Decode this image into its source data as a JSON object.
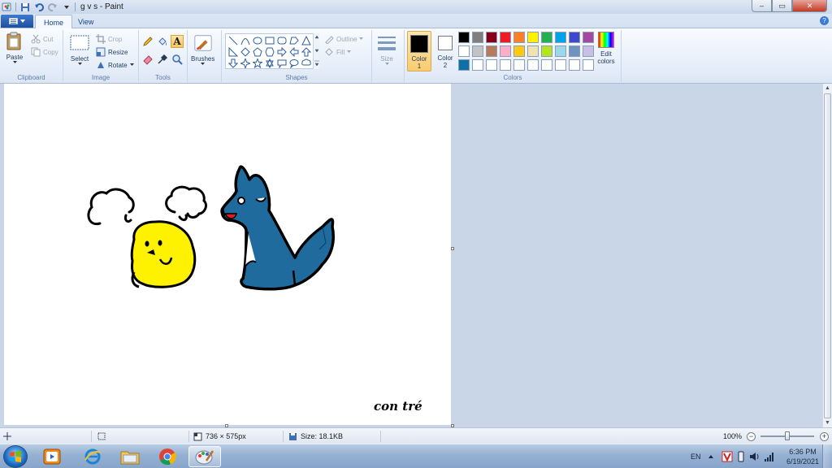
{
  "window": {
    "title": "g v s - Paint",
    "controls": {
      "minimize": "–",
      "maximize": "▭",
      "close": "✕"
    }
  },
  "tabs": [
    {
      "label": "Home",
      "active": true
    },
    {
      "label": "View",
      "active": false
    }
  ],
  "help_label": "?",
  "ribbon": {
    "clipboard": {
      "group_label": "Clipboard",
      "paste": "Paste",
      "cut": "Cut",
      "copy": "Copy"
    },
    "image": {
      "group_label": "Image",
      "select": "Select",
      "crop": "Crop",
      "resize": "Resize",
      "rotate": "Rotate"
    },
    "tools": {
      "group_label": "Tools",
      "text_tool": "A"
    },
    "brushes": {
      "label": "Brushes"
    },
    "shapes": {
      "group_label": "Shapes",
      "outline": "Outline",
      "fill": "Fill"
    },
    "size": {
      "label": "Size"
    },
    "colors": {
      "group_label": "Colors",
      "color1_label": "Color",
      "color1_num": "1",
      "color1_value": "#000000",
      "color2_label": "Color",
      "color2_num": "2",
      "color2_value": "#ffffff",
      "edit_colors_line1": "Edit",
      "edit_colors_line2": "colors",
      "palette_row1": [
        "#000000",
        "#7f7f7f",
        "#880015",
        "#ed1c24",
        "#ff7f27",
        "#fff200",
        "#22b14c",
        "#00a2e8",
        "#3f48cc",
        "#a349a4"
      ],
      "palette_row2": [
        "#ffffff",
        "#c3c3c3",
        "#b97a57",
        "#ffaec9",
        "#ffc90e",
        "#efe4b0",
        "#b5e61d",
        "#99d9ea",
        "#7092be",
        "#c8bfe7"
      ],
      "palette_row3": [
        "#0f6fa8",
        "#ffffff",
        "#ffffff",
        "#ffffff",
        "#ffffff",
        "#ffffff",
        "#ffffff",
        "#ffffff",
        "#ffffff",
        "#ffffff"
      ]
    }
  },
  "canvas": {
    "signature": "con tré",
    "drawing_colors": {
      "chick": "#fff200",
      "wolf": "#1f6b9e",
      "outline": "#000000",
      "tongue": "#e01b24"
    }
  },
  "status": {
    "dimensions": "736 × 575px",
    "size": "Size: 18.1KB",
    "zoom": "100%",
    "zoom_level_fraction": 0.5
  },
  "taskbar": {
    "language": "EN",
    "time": "6:36 PM",
    "date": "6/19/2021"
  }
}
